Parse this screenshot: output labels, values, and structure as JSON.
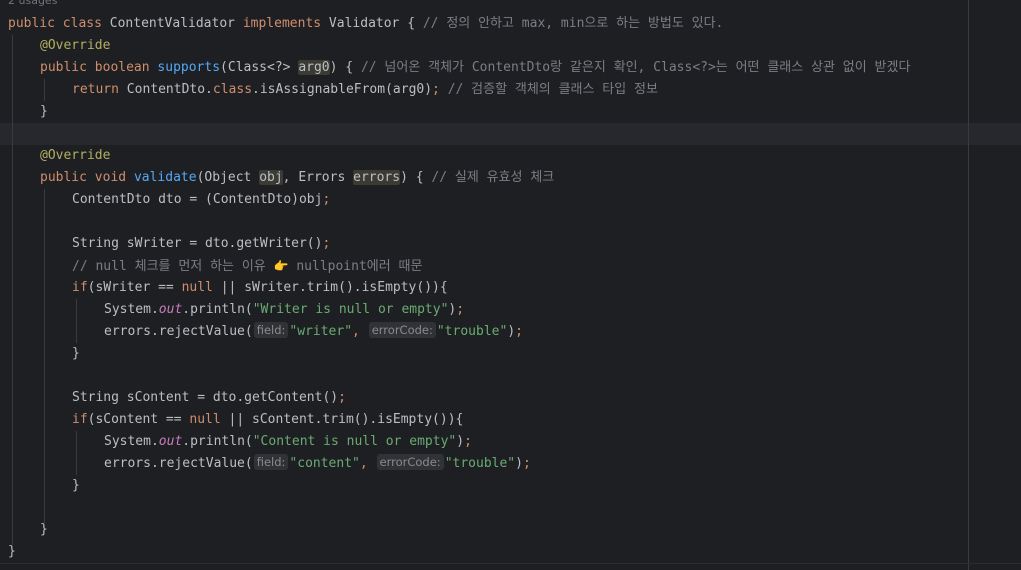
{
  "header": {
    "usages": "2 usages"
  },
  "code": {
    "l1": {
      "kw_public": "public",
      "kw_class": "class",
      "class_name": " ContentValidator ",
      "kw_implements": "implements",
      "rest": " Validator { ",
      "comment": "// 정의 안하고 max, min으로 하는 방법도 있다."
    },
    "l2": {
      "annotation": "@Override"
    },
    "l3": {
      "kw_public": "public",
      "kw_type": "boolean",
      "method": "supports",
      "open": "(Class<?> ",
      "param": "arg0",
      "close": ") { ",
      "comment": "// 넘어온 객체가 ContentDto랑 같은지 확인, Class<?>는 어떤 클래스 상관 없이 받겠다"
    },
    "l4": {
      "kw_return": "return",
      "text_a": " ContentDto.",
      "kw_class": "class",
      "text_b": ".isAssignableFrom(arg0)",
      "semi": ";",
      "comment": " // 검증할 객체의 클래스 타입 정보"
    },
    "l5": {
      "text": "}"
    },
    "l7": {
      "annotation": "@Override"
    },
    "l8": {
      "kw_public": "public",
      "kw_void": "void",
      "method": "validate",
      "open": "(Object ",
      "param1": "obj",
      "mid": ", Errors ",
      "param2": "errors",
      "close": ") { ",
      "comment": "// 실제 유효성 체크"
    },
    "l9": {
      "text": "ContentDto dto = (ContentDto)obj",
      "semi": ";"
    },
    "l11": {
      "text": "String sWriter = dto.getWriter()",
      "semi": ";"
    },
    "l12": {
      "comment_a": "// null 체크를 먼저 하는 이유 ",
      "emoji": "👉",
      "comment_b": " nullpoint에러 때문"
    },
    "l13": {
      "kw_if": "if",
      "open": "(sWriter == ",
      "kw_null": "null",
      "rest": " || sWriter.trim().isEmpty()){"
    },
    "l14": {
      "text_a": "System.",
      "static": "out",
      "text_b": ".println(",
      "str": "\"Writer is null or empty\"",
      "text_c": ")",
      "semi": ";"
    },
    "l15": {
      "text_a": "errors.rejectValue(",
      "hint_field": "field:",
      "str1": "\"writer\"",
      "comma": ",",
      "hint_code": "errorCode:",
      "str2": "\"trouble\"",
      "text_c": ")",
      "semi": ";"
    },
    "l16": {
      "text": "}"
    },
    "l18": {
      "text": "String sContent = dto.getContent()",
      "semi": ";"
    },
    "l19": {
      "kw_if": "if",
      "open": "(sContent == ",
      "kw_null": "null",
      "rest": " || sContent.trim().isEmpty()){"
    },
    "l20": {
      "text_a": "System.",
      "static": "out",
      "text_b": ".println(",
      "str": "\"Content is null or empty\"",
      "text_c": ")",
      "semi": ";"
    },
    "l21": {
      "text_a": "errors.rejectValue(",
      "hint_field": "field:",
      "str1": "\"content\"",
      "comma": ",",
      "hint_code": "errorCode:",
      "str2": "\"trouble\"",
      "text_c": ")",
      "semi": ";"
    },
    "l22": {
      "text": "}"
    },
    "l24": {
      "text": "}"
    },
    "l25": {
      "text": "}"
    }
  }
}
